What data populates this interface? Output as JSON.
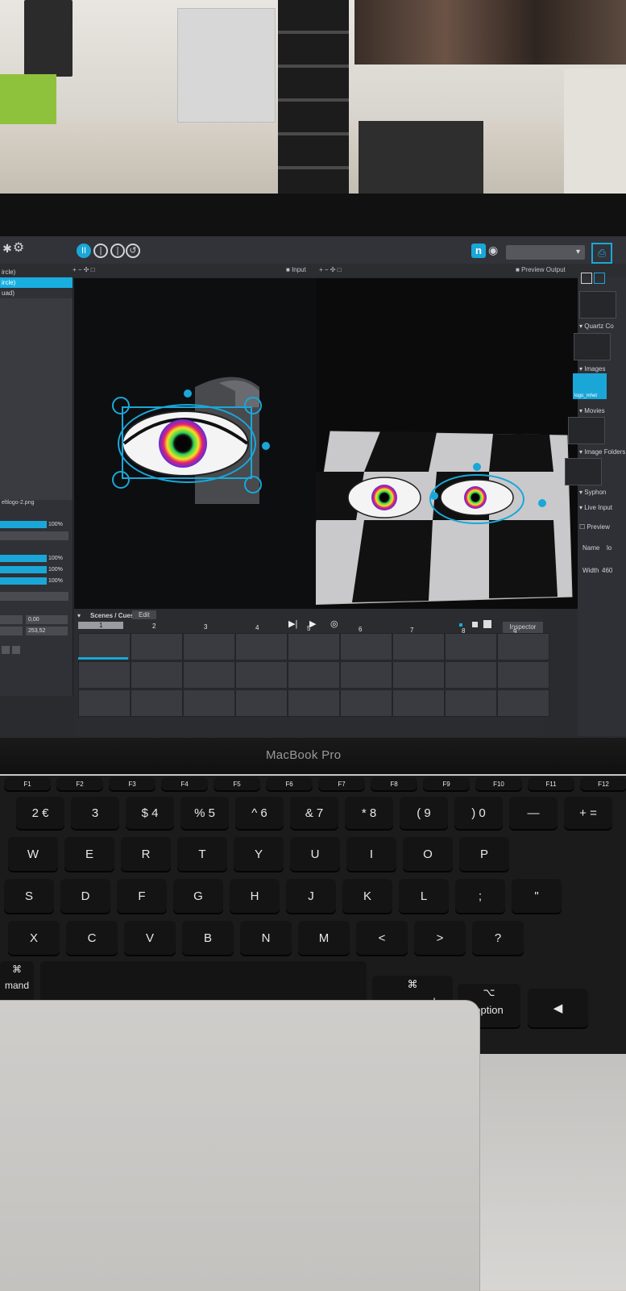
{
  "laptop": {
    "brand_label": "MacBook Pro"
  },
  "app": {
    "toolbar": {
      "n_button": "n",
      "doc_icon": "file-icon"
    },
    "subbar": {
      "left_controls": "+ − ✣ □",
      "input_label": "Input",
      "input_controls": "+ − ✣ □",
      "preview_output_label": "Preview Output"
    },
    "layers": {
      "items": [
        {
          "label": "ircle)",
          "selected": false
        },
        {
          "label": "ircle)",
          "selected": true
        },
        {
          "label": "uad)",
          "selected": false
        }
      ]
    },
    "properties": {
      "image_name": "eltlogo-2.png",
      "opacity": [
        {
          "value": "100%"
        }
      ],
      "rgb": [
        {
          "value": "100%"
        },
        {
          "value": "100%"
        },
        {
          "value": "100%"
        }
      ],
      "x_value": "0,00",
      "y_value": "253,52"
    },
    "right_panel": {
      "sections": [
        {
          "label": "Quartz Co"
        },
        {
          "label": "Images"
        },
        {
          "label": "Movies"
        },
        {
          "label": "Image Folders"
        },
        {
          "label": "Syphon"
        },
        {
          "label": "Live Input"
        }
      ],
      "image_thumb_label": "logo_mhet",
      "preview_label": "Preview",
      "name_label": "Name",
      "name_value": "lo",
      "width_label": "Width",
      "width_value": "460"
    },
    "scenes": {
      "title": "Scenes / Cues",
      "edit_label": "Edit",
      "inspector_label": "Inspector",
      "cue_numbers": [
        "1",
        "2",
        "3",
        "4",
        "5",
        "6",
        "7",
        "8",
        "9"
      ]
    }
  },
  "keyboard": {
    "fn_row": [
      "F1",
      "F2",
      "F3",
      "F4",
      "F5",
      "F6",
      "F7",
      "F8",
      "F9",
      "F10",
      "F11",
      "F12"
    ],
    "num_row": [
      "2 €",
      "3",
      "$ 4",
      "% 5",
      "^ 6",
      "& 7",
      "* 8",
      "( 9",
      ") 0",
      "—",
      "+ ="
    ],
    "row_q": [
      "W",
      "E",
      "R",
      "T",
      "Y",
      "U",
      "I",
      "O",
      "P"
    ],
    "row_a": [
      "S",
      "D",
      "F",
      "G",
      "H",
      "J",
      "K",
      "L",
      ";",
      "\""
    ],
    "row_z": [
      "X",
      "C",
      "V",
      "B",
      "N",
      "M",
      "<",
      ">",
      "?"
    ],
    "mod_left": "mand",
    "command_label": "command",
    "command_symbol": "⌘",
    "option_label": "option",
    "option_symbol": "⌥",
    "left_cmd_symbol": "⌘"
  },
  "colors": {
    "accent": "#1aa7d8",
    "selection": "#19aee0"
  }
}
